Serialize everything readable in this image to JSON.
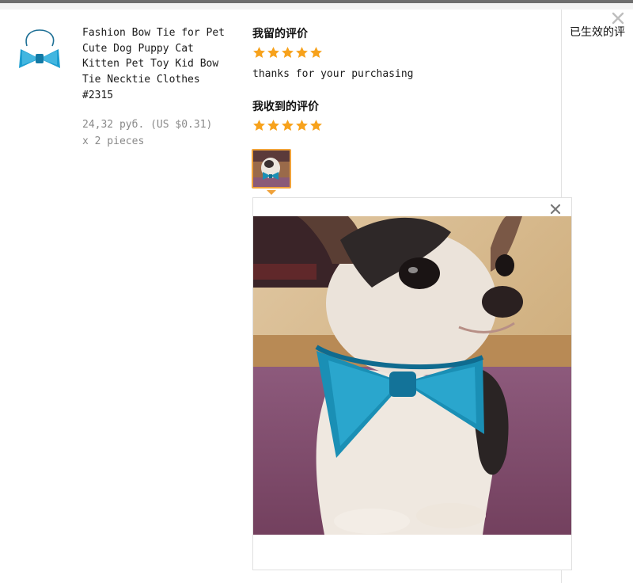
{
  "product": {
    "title_lines": [
      "Fashion Bow Tie for Pet",
      "Cute Dog Puppy Cat",
      "Kitten Pet Toy Kid Bow",
      "Tie Necktie Clothes",
      "#2315"
    ],
    "price": "24,32 руб. (US $0.31)",
    "quantity": "x 2 pieces",
    "thumbnail_icon": "blue-bow-tie-image"
  },
  "my_review": {
    "heading": "我留的评价",
    "rating": 5,
    "text": "thanks for your purchasing"
  },
  "received_review": {
    "heading": "我收到的评价",
    "rating": 5
  },
  "status_tab": "已生效的评",
  "colors": {
    "star": "#f7a21c",
    "thumb_border": "#f0a23a",
    "bow_tie": "#1a8fb5"
  },
  "icons": {
    "dialog_close": "close-icon",
    "preview_close": "close-icon",
    "photo": "dog-with-bow-tie-photo"
  }
}
